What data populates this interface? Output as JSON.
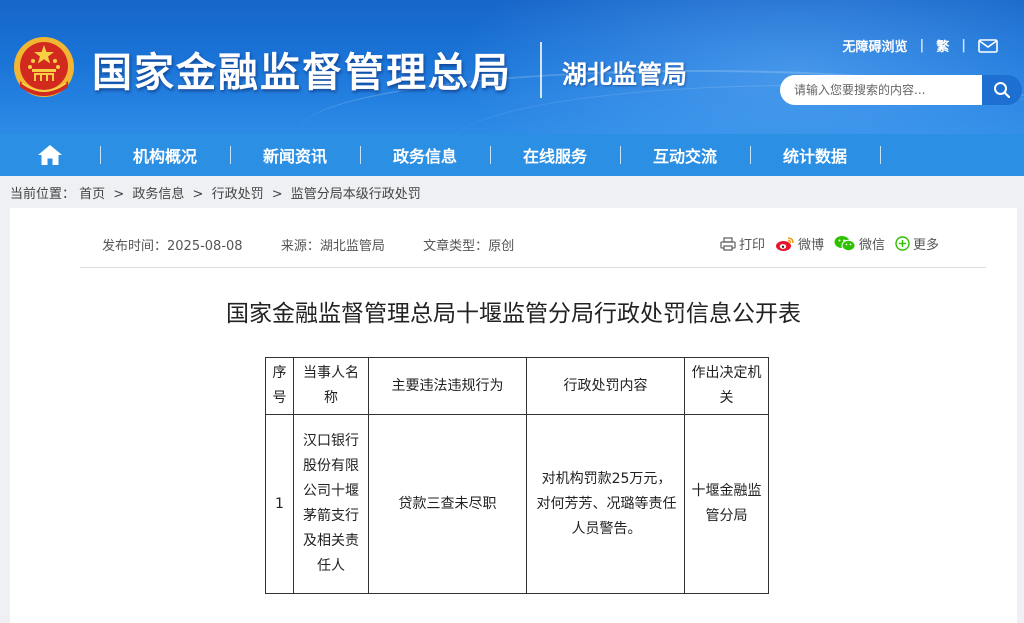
{
  "header": {
    "site_title": "国家金融监督管理总局",
    "sub_title": "湖北监管局",
    "links": {
      "accessible": "无障碍浏览",
      "traditional": "繁"
    },
    "search": {
      "placeholder": "请输入您要搜索的内容..."
    }
  },
  "nav": {
    "items": [
      {
        "label": "机构概况"
      },
      {
        "label": "新闻资讯"
      },
      {
        "label": "政务信息"
      },
      {
        "label": "在线服务"
      },
      {
        "label": "互动交流"
      },
      {
        "label": "统计数据"
      }
    ]
  },
  "breadcrumb": {
    "prefix": "当前位置：",
    "items": [
      {
        "label": "首页"
      },
      {
        "label": "政务信息"
      },
      {
        "label": "行政处罚"
      },
      {
        "label": "监管分局本级行政处罚"
      }
    ],
    "separator": ">"
  },
  "article": {
    "publish_label": "发布时间：",
    "publish_date": "2025-08-08",
    "source_label": "来源：",
    "source": "湖北监管局",
    "type_label": "文章类型：",
    "type": "原创",
    "share": {
      "print": "打印",
      "weibo": "微博",
      "wechat": "微信",
      "more": "更多"
    },
    "title": "国家金融监督管理总局十堰监管分局行政处罚信息公开表"
  },
  "table": {
    "headers": [
      "序号",
      "当事人名称",
      "主要违法违规行为",
      "行政处罚内容",
      "作出决定机关"
    ],
    "rows": [
      {
        "no": "1",
        "party": "汉口银行股份有限公司十堰茅箭支行及相关责任人",
        "violation": "贷款三查未尽职",
        "penalty": "对机构罚款25万元，对何芳芳、况璐等责任人员警告。",
        "authority": "十堰金融监管分局"
      }
    ]
  },
  "colors": {
    "header_blue": "#1a74d8",
    "nav_blue": "#2b8fe4",
    "emblem_red": "#d22a1f",
    "emblem_gold": "#f4c23a"
  }
}
